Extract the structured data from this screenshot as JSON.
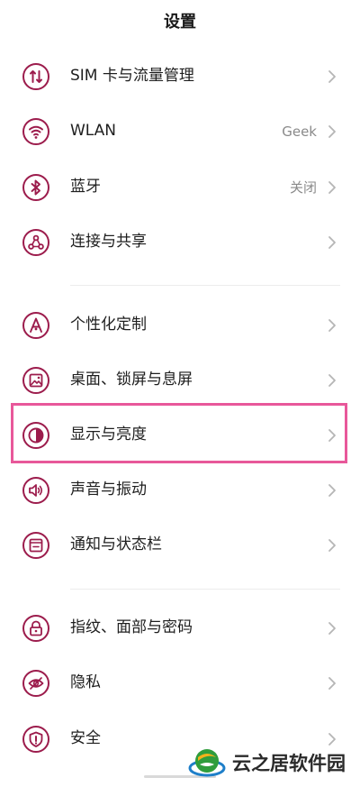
{
  "header": {
    "title": "设置"
  },
  "theme": {
    "accent": "#9c1c4c",
    "highlight": "#e8589a",
    "chevron": "#b5b5b5"
  },
  "items": [
    {
      "label": "SIM 卡与流量管理",
      "icon": "sim-data-icon"
    },
    {
      "label": "WLAN",
      "value": "Geek",
      "icon": "wifi-icon"
    },
    {
      "label": "蓝牙",
      "value": "关闭",
      "icon": "bluetooth-icon"
    },
    {
      "label": "连接与共享",
      "icon": "share-icon"
    },
    {
      "label": "个性化定制",
      "icon": "personalize-icon"
    },
    {
      "label": "桌面、锁屏与息屏",
      "icon": "wallpaper-icon"
    },
    {
      "label": "显示与亮度",
      "icon": "brightness-icon"
    },
    {
      "label": "声音与振动",
      "icon": "sound-icon"
    },
    {
      "label": "通知与状态栏",
      "icon": "notification-icon"
    },
    {
      "label": "指纹、面部与密码",
      "icon": "lock-icon"
    },
    {
      "label": "隐私",
      "icon": "privacy-eye-icon"
    },
    {
      "label": "安全",
      "icon": "shield-icon"
    }
  ],
  "watermark": {
    "text": "云之居软件园"
  }
}
